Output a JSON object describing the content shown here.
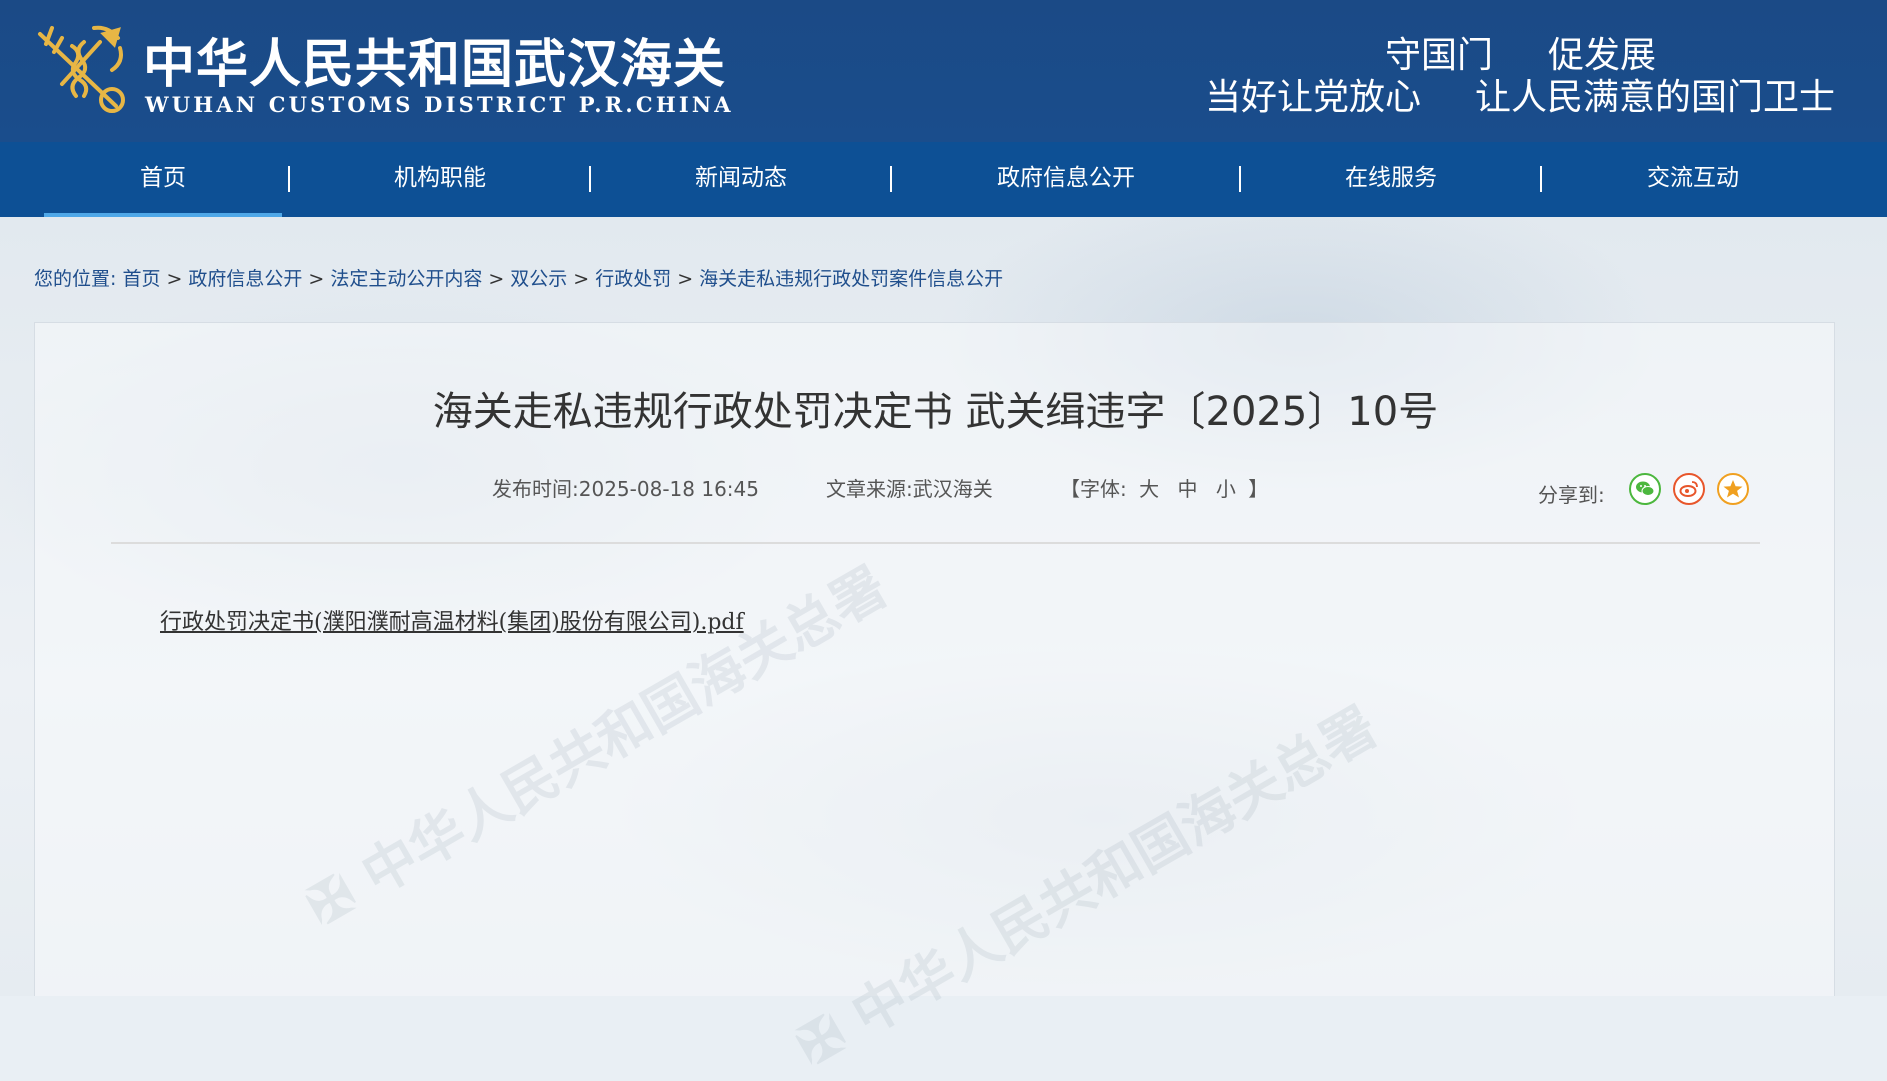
{
  "header": {
    "title_cn": "中华人民共和国武汉海关",
    "title_en": "WUHAN CUSTOMS DISTRICT P.R.CHINA",
    "slogans": [
      "守国门",
      "促发展",
      "当好让党放心",
      "让人民满意的国门卫士"
    ]
  },
  "nav": {
    "items": [
      {
        "label": "首页"
      },
      {
        "label": "机构职能"
      },
      {
        "label": "新闻动态"
      },
      {
        "label": "政府信息公开"
      },
      {
        "label": "在线服务"
      },
      {
        "label": "交流互动"
      }
    ],
    "active_index": 0
  },
  "breadcrumb": {
    "prefix": "您的位置:",
    "items": [
      "首页",
      "政府信息公开",
      "法定主动公开内容",
      "双公示",
      "行政处罚",
      "海关走私违规行政处罚案件信息公开"
    ],
    "separator": ">"
  },
  "article": {
    "title": "海关走私违规行政处罚决定书 武关缉违字〔2025〕10号",
    "publish_label": "发布时间:",
    "publish_time": "2025-08-18 16:45",
    "source_label": "文章来源:",
    "source": "武汉海关",
    "font_label_open": "【字体:",
    "font_sizes": [
      "大",
      "中",
      "小"
    ],
    "font_label_close": "】",
    "share_label": "分享到:",
    "share_icons": [
      "wechat-icon",
      "weibo-icon",
      "favorite-icon"
    ],
    "attachment": "行政处罚决定书(濮阳濮耐高温材料(集团)股份有限公司).pdf"
  },
  "colors": {
    "header_bg": "#1b4a86",
    "nav_bg": "#0d5095",
    "nav_active_underline": "#4fa8e8",
    "link": "#1f4e8c",
    "wechat": "#4cb73e",
    "weibo": "#e8562b",
    "favorite": "#f0a020"
  }
}
